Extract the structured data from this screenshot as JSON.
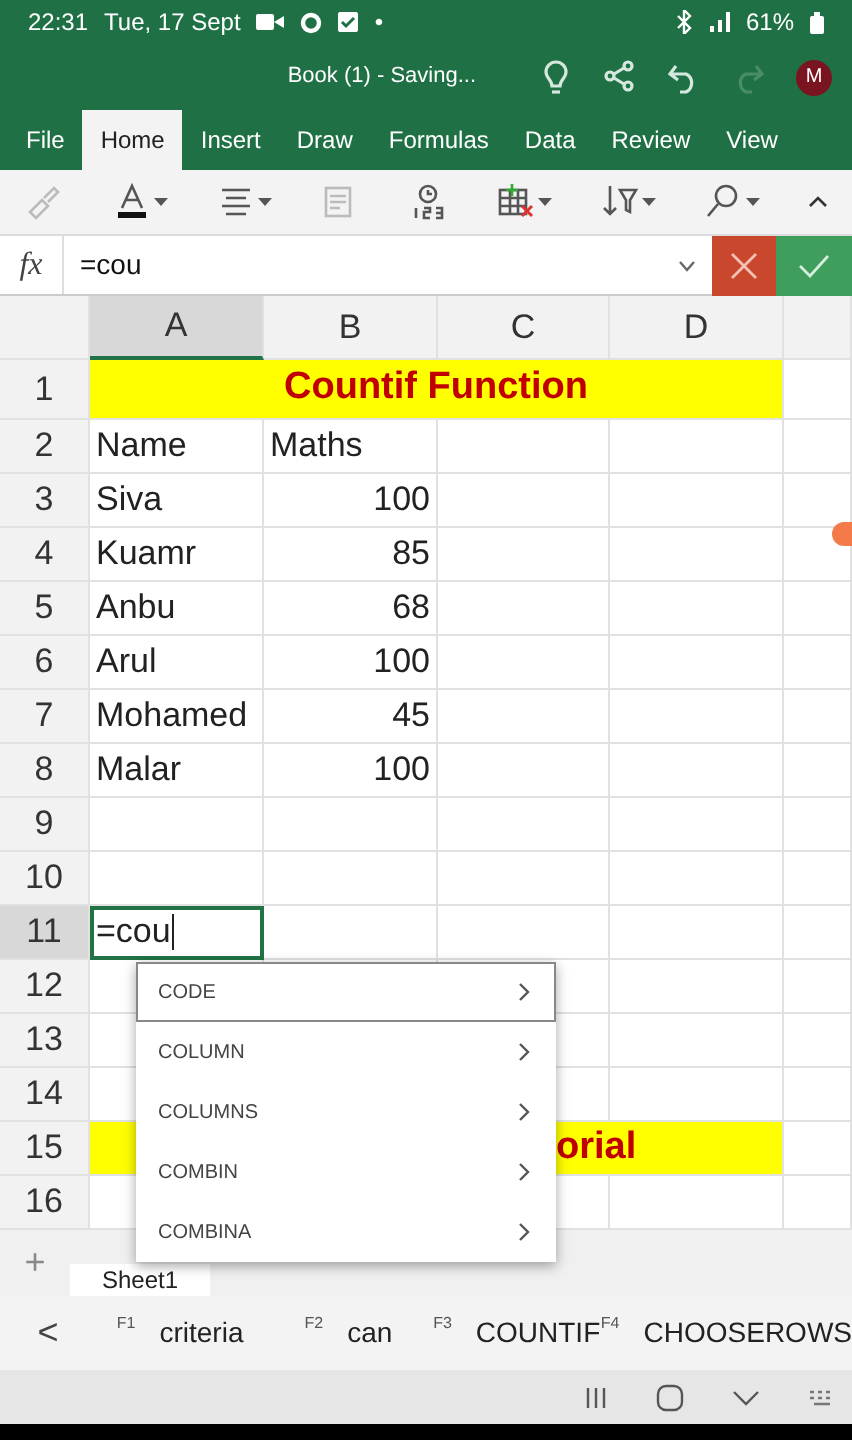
{
  "status_bar": {
    "time": "22:31",
    "date": "Tue, 17 Sept",
    "dot": "•",
    "battery": "61%"
  },
  "title_bar": {
    "title": "Book (1) - Saving...",
    "avatar": "M",
    "actions": [
      {
        "kind": "lightbulb",
        "disabled": false
      },
      {
        "kind": "share",
        "disabled": false
      },
      {
        "kind": "undo",
        "disabled": false
      },
      {
        "kind": "redo",
        "disabled": true
      }
    ]
  },
  "ribbon_tabs": [
    {
      "label": "File",
      "selected": false
    },
    {
      "label": "Home",
      "selected": true
    },
    {
      "label": "Insert",
      "selected": false
    },
    {
      "label": "Draw",
      "selected": false
    },
    {
      "label": "Formulas",
      "selected": false
    },
    {
      "label": "Data",
      "selected": false
    },
    {
      "label": "Review",
      "selected": false
    },
    {
      "label": "View",
      "selected": false
    }
  ],
  "toolbar": [
    {
      "kind": "format-painter",
      "disabled": true,
      "menu": false
    },
    {
      "kind": "font-color",
      "disabled": false,
      "menu": true
    },
    {
      "kind": "align",
      "disabled": false,
      "menu": true
    },
    {
      "kind": "cell-styles",
      "disabled": true,
      "menu": false
    },
    {
      "kind": "number-format",
      "disabled": false,
      "menu": false
    },
    {
      "kind": "insert-delete",
      "disabled": false,
      "menu": true
    },
    {
      "kind": "sort-filter",
      "disabled": false,
      "menu": true
    },
    {
      "kind": "find",
      "disabled": false,
      "menu": true
    }
  ],
  "formula_bar": {
    "fx": "fx",
    "value": "=cou"
  },
  "sheet": {
    "columns": [
      {
        "label": "A",
        "selected": true
      },
      {
        "label": "B",
        "selected": false
      },
      {
        "label": "C",
        "selected": false
      },
      {
        "label": "D",
        "selected": false
      }
    ],
    "rows": [
      {
        "number": "1",
        "selected": false,
        "kind": "title",
        "text": "Countif Function"
      },
      {
        "number": "2",
        "selected": false,
        "kind": "data",
        "cells": [
          {
            "text": "Name",
            "numeric": false,
            "editing": false
          },
          {
            "text": "Maths",
            "numeric": false,
            "editing": false
          }
        ]
      },
      {
        "number": "3",
        "selected": false,
        "kind": "data",
        "cells": [
          {
            "text": "Siva",
            "numeric": false,
            "editing": false
          },
          {
            "text": "100",
            "numeric": true,
            "editing": false
          }
        ]
      },
      {
        "number": "4",
        "selected": false,
        "kind": "data",
        "cells": [
          {
            "text": "Kuamr",
            "numeric": false,
            "editing": false
          },
          {
            "text": "85",
            "numeric": true,
            "editing": false
          }
        ]
      },
      {
        "number": "5",
        "selected": false,
        "kind": "data",
        "cells": [
          {
            "text": "Anbu",
            "numeric": false,
            "editing": false
          },
          {
            "text": "68",
            "numeric": true,
            "editing": false
          }
        ]
      },
      {
        "number": "6",
        "selected": false,
        "kind": "data",
        "cells": [
          {
            "text": "Arul",
            "numeric": false,
            "editing": false
          },
          {
            "text": "100",
            "numeric": true,
            "editing": false
          }
        ]
      },
      {
        "number": "7",
        "selected": false,
        "kind": "data",
        "cells": [
          {
            "text": "Mohamed",
            "numeric": false,
            "editing": false
          },
          {
            "text": "45",
            "numeric": true,
            "editing": false
          }
        ]
      },
      {
        "number": "8",
        "selected": false,
        "kind": "data",
        "cells": [
          {
            "text": "Malar",
            "numeric": false,
            "editing": false
          },
          {
            "text": "100",
            "numeric": true,
            "editing": false
          }
        ]
      },
      {
        "number": "9",
        "selected": false,
        "kind": "data",
        "cells": []
      },
      {
        "number": "10",
        "selected": false,
        "kind": "data",
        "cells": []
      },
      {
        "number": "11",
        "selected": true,
        "kind": "data",
        "cells": [
          {
            "text": "=cou",
            "numeric": false,
            "editing": true
          }
        ]
      },
      {
        "number": "12",
        "selected": false,
        "kind": "data",
        "cells": []
      },
      {
        "number": "13",
        "selected": false,
        "kind": "data",
        "cells": []
      },
      {
        "number": "14",
        "selected": false,
        "kind": "data",
        "cells": []
      },
      {
        "number": "15",
        "selected": false,
        "kind": "title",
        "text": "orial"
      },
      {
        "number": "16",
        "selected": false,
        "kind": "data",
        "cells": []
      }
    ]
  },
  "autocomplete": [
    {
      "label": "CODE",
      "selected": true
    },
    {
      "label": "COLUMN",
      "selected": false
    },
    {
      "label": "COLUMNS",
      "selected": false
    },
    {
      "label": "COMBIN",
      "selected": false
    },
    {
      "label": "COMBINA",
      "selected": false
    }
  ],
  "sheet_tabs": {
    "add": "+",
    "tabs": [
      {
        "label": "Sheet1",
        "selected": true
      }
    ]
  },
  "suggestions": {
    "back": "<",
    "items": [
      {
        "key": "F1",
        "label": "criteria"
      },
      {
        "key": "F2",
        "label": "can"
      },
      {
        "key": "F3",
        "label": "COUNTIF"
      },
      {
        "key": "F4",
        "label": "CHOOSEROWS"
      }
    ]
  }
}
